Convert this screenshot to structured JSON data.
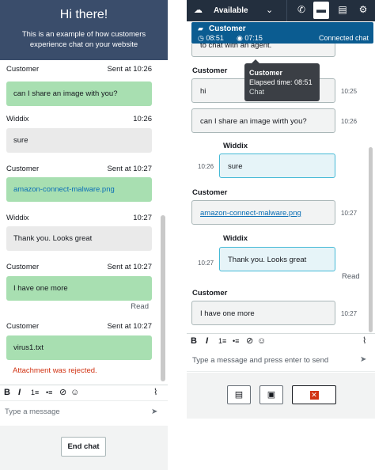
{
  "customer_widget": {
    "header": {
      "title": "Hi there!",
      "subtitle": "This is an example of how customers experience chat on your website"
    },
    "messages": [
      {
        "sender": "Customer",
        "time": "Sent at 10:26",
        "text": "can I share an image with you?",
        "kind": "customer"
      },
      {
        "sender": "Widdix",
        "time": "10:26",
        "text": "sure",
        "kind": "agent"
      },
      {
        "sender": "Customer",
        "time": "Sent at 10:27",
        "text": "amazon-connect-malware.png",
        "kind": "customer-link"
      },
      {
        "sender": "Widdix",
        "time": "10:27",
        "text": "Thank you. Looks great",
        "kind": "agent"
      },
      {
        "sender": "Customer",
        "time": "Sent at 10:27",
        "text": "I have one more",
        "kind": "customer",
        "receipt": "Read"
      },
      {
        "sender": "Customer",
        "time": "Sent at 10:27",
        "text": "virus1.txt",
        "kind": "customer",
        "error": "Attachment was rejected."
      }
    ],
    "toolbar": {
      "bold": "B",
      "italic": "I",
      "numbered_list": "1≡",
      "bullet_list": "•≡",
      "link": "⊘",
      "emoji": "☺",
      "attach": "⌇"
    },
    "input": {
      "placeholder": "Type a message"
    },
    "end_chat_label": "End chat"
  },
  "agent_ccp": {
    "status": "Available",
    "contact": {
      "name": "Customer",
      "timer1": "08:51",
      "timer2": "07:15",
      "state": "Connected chat"
    },
    "tooltip": {
      "title": "Customer",
      "elapsed_label": "Elapsed time:",
      "elapsed_value": "08:51",
      "subtitle": "Chat"
    },
    "messages": [
      {
        "sender": "",
        "time": "",
        "text": "to chat with an agent.",
        "kind": "customer"
      },
      {
        "sender": "Customer",
        "time": "10:25",
        "text": "hi",
        "kind": "customer"
      },
      {
        "sender": "",
        "time": "10:26",
        "text": "can I share an image wirth you?",
        "kind": "customer"
      },
      {
        "sender": "Widdix",
        "time": "10:26",
        "text": "sure",
        "kind": "agent"
      },
      {
        "sender": "Customer",
        "time": "10:27",
        "text": "amazon-connect-malware.png",
        "kind": "customer-link"
      },
      {
        "sender": "Widdix",
        "time": "10:27",
        "text": "Thank you. Looks great",
        "kind": "agent",
        "receipt": "Read"
      },
      {
        "sender": "Customer",
        "time": "10:27",
        "text": "I have one more",
        "kind": "customer"
      }
    ],
    "input": {
      "placeholder": "Type a message and press enter to send"
    }
  },
  "colors": {
    "widget_header": "#3a4d6b",
    "customer_bubble": "#a8dfb1",
    "agent_bubble": "#eaeaea",
    "ccp_topbar": "#232f3e",
    "contact_bar": "#0b5c91",
    "error": "#d13212"
  }
}
